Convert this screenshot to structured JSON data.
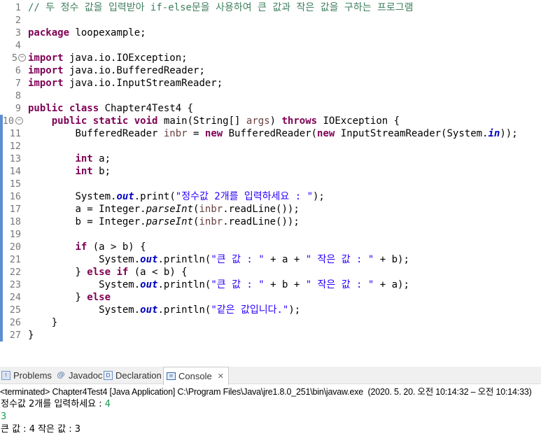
{
  "editor": {
    "lines": [
      {
        "n": "1"
      },
      {
        "n": "2"
      },
      {
        "n": "3"
      },
      {
        "n": "4"
      },
      {
        "n": "5"
      },
      {
        "n": "6"
      },
      {
        "n": "7"
      },
      {
        "n": "8"
      },
      {
        "n": "9"
      },
      {
        "n": "10"
      },
      {
        "n": "11"
      },
      {
        "n": "12"
      },
      {
        "n": "13"
      },
      {
        "n": "14"
      },
      {
        "n": "15"
      },
      {
        "n": "16"
      },
      {
        "n": "17"
      },
      {
        "n": "18"
      },
      {
        "n": "19"
      },
      {
        "n": "20"
      },
      {
        "n": "21"
      },
      {
        "n": "22"
      },
      {
        "n": "23"
      },
      {
        "n": "24"
      },
      {
        "n": "25"
      },
      {
        "n": "26"
      },
      {
        "n": "27"
      }
    ],
    "code": {
      "comment": "// 두 정수 값을 입력받아 if-else문을 사용하여 큰 값과 작은 값을 구하는 프로그램",
      "kw_package": "package",
      "pkg_name": " loopexample;",
      "kw_import": "import",
      "import1": " java.io.IOException;",
      "import2": " java.io.BufferedReader;",
      "import3": " java.io.InputStreamReader;",
      "kw_public": "public",
      "kw_class": "class",
      "class_name": " Chapter4Test4 {",
      "kw_static": "static",
      "kw_void": "void",
      "main_sig": " main(String[] ",
      "args": "args",
      "paren_close": ") ",
      "kw_throws": "throws",
      "throws_rest": " IOException {",
      "br_decl": "BufferedReader ",
      "inbr": "inbr",
      "eq": " = ",
      "kw_new": "new",
      "br_ctor": " BufferedReader(",
      "isr_ctor": " InputStreamReader(System.",
      "in_field": "in",
      "br_end": "));",
      "kw_int": "int",
      "a_decl": " a;",
      "b_decl": " b;",
      "sys": "System.",
      "out": "out",
      "print_open": ".print(",
      "prompt_str": "\"정수값 2개를 입력하세요 : \"",
      "stmt_end": ");",
      "a_assign": "a = Integer.",
      "b_assign": "b = Integer.",
      "parseInt": "parseInt",
      "readline_open": "(",
      "readline_rest": ".readLine());",
      "kw_if": "if",
      "if_cond": " (a > b) {",
      "println_open": ".println(",
      "big_str": "\"큰 값 : \"",
      "plus_a": " + a + ",
      "plus_b": " + b + ",
      "small_str": "\" 작은 값 : \"",
      "end_b": " + b);",
      "end_a": " + a);",
      "brace_close": "} ",
      "kw_else": "else",
      "elseif_cond": " (a < b) {",
      "same_str": "\"같은 값입니다.\"",
      "close_brace": "}"
    }
  },
  "views": {
    "tabs": [
      {
        "label": "Problems",
        "icon": "problems-icon"
      },
      {
        "label": "Javadoc",
        "icon": "javadoc-icon"
      },
      {
        "label": "Declaration",
        "icon": "declaration-icon"
      },
      {
        "label": "Console",
        "icon": "console-icon"
      }
    ],
    "close_glyph": "✕"
  },
  "console": {
    "terminated": "<terminated> Chapter4Test4 [Java Application] C:\\Program Files\\Java\\jre1.8.0_251\\bin\\javaw.exe  (2020. 5. 20. 오전 10:14:32 – 오전 10:14:33)",
    "prompt": "정수값 2개를 입력하세요 : ",
    "input1": "4",
    "input2": "3",
    "result": "큰 값 : 4 작은 값 : 3"
  },
  "colors": {
    "keyword": "#7f0055",
    "string": "#2a00ff",
    "comment": "#3f7f5f",
    "field": "#0000c0",
    "input": "#19a053"
  }
}
